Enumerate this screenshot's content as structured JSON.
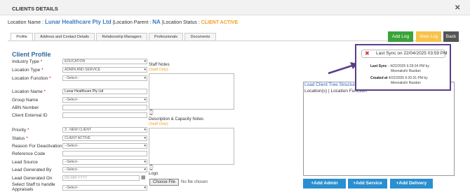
{
  "header": {
    "title": "CLIENTS DETAILS",
    "close_glyph": "✕"
  },
  "location": {
    "name_label": "Location Name :",
    "name_value": "Lunar Healthcare Pty Ltd",
    "parent_label": "|Location Parent :",
    "parent_value": "NA",
    "status_label": "|Location Status :",
    "status_value": "CLIENT ACTIVE"
  },
  "tabs": [
    {
      "label": "Profile"
    },
    {
      "label": "Address and Contact Details"
    },
    {
      "label": "Relationship Managers"
    },
    {
      "label": "Professionals"
    },
    {
      "label": "Documents"
    }
  ],
  "actions": {
    "add_log": "Add Log",
    "view_log": "View Log",
    "back": "Back"
  },
  "colors": {
    "add_log": "#3aa33a",
    "view_log": "#f7c24a",
    "back": "#555555",
    "primary": "#2a8fd0",
    "popup_border": "#5a3d8a",
    "arrow": "#5a3d8a"
  },
  "profile": {
    "title": "Client Profile",
    "fields": {
      "industry_type": {
        "label": "Industry Type",
        "value": "EDUCATION"
      },
      "location_type": {
        "label": "Location Type",
        "value": "ADMIN AND SERVICE"
      },
      "location_function": {
        "label": "Location Function",
        "value": "--Select--"
      },
      "location_name": {
        "label": "Location Name",
        "value": "Lunar Healthcare Pty Ltd"
      },
      "group_name": {
        "label": "Group Name",
        "value": "--Select--"
      },
      "abn_number": {
        "label": "ABN Number",
        "value": ""
      },
      "client_external_id": {
        "label": "Client External ID",
        "value": ""
      },
      "priority": {
        "label": "Priority",
        "value": "3 - NEW CLIENT"
      },
      "status": {
        "label": "Status",
        "value": "CLIENT ACTIVE"
      },
      "reason_deactivation": {
        "label": "Reason For Deactivation",
        "value": "--Select--"
      },
      "reference_code": {
        "label": "Reference Code",
        "value": ""
      },
      "lead_source": {
        "label": "Lead Source",
        "value": "--Select--"
      },
      "lead_generated_by": {
        "label": "Lead Generated By",
        "value": "--Select--"
      },
      "lead_generated_on": {
        "label": "Lead Generated On",
        "placeholder": "DD-MM-YYYY"
      },
      "select_staff": {
        "label_line1": "Select Staff to handle",
        "label_line2": "Appraisals",
        "value": "--Select--"
      }
    },
    "required_mark": "*",
    "staff_notes": {
      "label": "Staff Notes",
      "sub": "(Staff Only)"
    },
    "desc_notes": {
      "label": "Description & Capacity Notes",
      "sub": "(Staff Only)"
    },
    "logo": {
      "label": "Logo",
      "button": "Choose File",
      "status": "No file chosen"
    }
  },
  "sync_popup": {
    "pill": "Last Sync on 22/04/2025 03:59 PM",
    "last_sync_label": "Last Sync",
    "last_sync_value": " - 4/22/2025 6:29:24 PM by",
    "last_sync_by": "Meenakshi Razdan",
    "created_label": "Created at",
    "created_value": " 4/22/2025 6:20:31 PM by",
    "created_by": "Meenakshi Razdan"
  },
  "tree": {
    "title": "Load Client Tree Structure",
    "subtitle": "Location(s) | Location Function"
  },
  "bottom_buttons": {
    "add_admin": "+Add Admin",
    "add_service": "+Add Service",
    "add_delivery": "+Add Delivery"
  }
}
